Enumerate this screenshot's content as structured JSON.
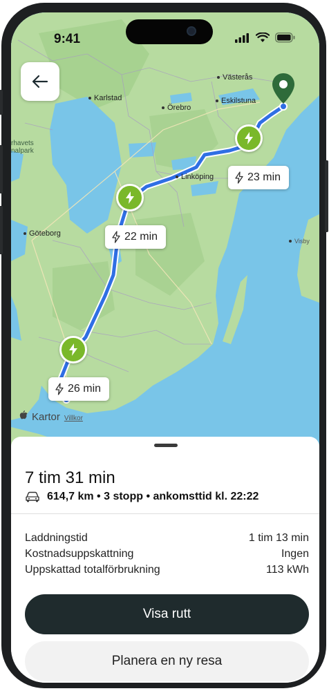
{
  "status_bar": {
    "time": "9:41"
  },
  "map": {
    "cities": {
      "vasteras": "Västerås",
      "karlstad": "Karlstad",
      "orebro": "Örebro",
      "eskilstuna": "Eskilstuna",
      "linkoping": "Linköping",
      "goteborg": "Göteborg",
      "visby": "Visby"
    },
    "park_label_1": "rhavets",
    "park_label_2": "nalpark",
    "stops": [
      {
        "time": "23 min"
      },
      {
        "time": "22 min"
      },
      {
        "time": "26 min"
      }
    ],
    "attribution": {
      "brand": "Kartor",
      "legal": "Villkor"
    }
  },
  "summary": {
    "duration": "7 tim 31 min",
    "details": "614,7 km • 3 stopp • ankomsttid kl. 22:22"
  },
  "stats": [
    {
      "label": "Laddningstid",
      "value": "1 tim 13 min"
    },
    {
      "label": "Kostnadsuppskattning",
      "value": "Ingen"
    },
    {
      "label": "Uppskattad totalförbrukning",
      "value": "113 kWh"
    }
  ],
  "actions": {
    "primary": "Visa rutt",
    "secondary": "Planera en ny resa"
  },
  "colors": {
    "route": "#2f6fe4",
    "charger": "#7ab82a",
    "destination_pin": "#2e6b3a",
    "primary_button": "#1f2b2d",
    "water": "#79c5e8",
    "land": "#b7dba0"
  },
  "icons": [
    "back-arrow-icon",
    "bolt-icon",
    "car-icon",
    "location-pin-icon",
    "signal-icon",
    "wifi-icon",
    "battery-icon",
    "apple-logo-icon"
  ]
}
